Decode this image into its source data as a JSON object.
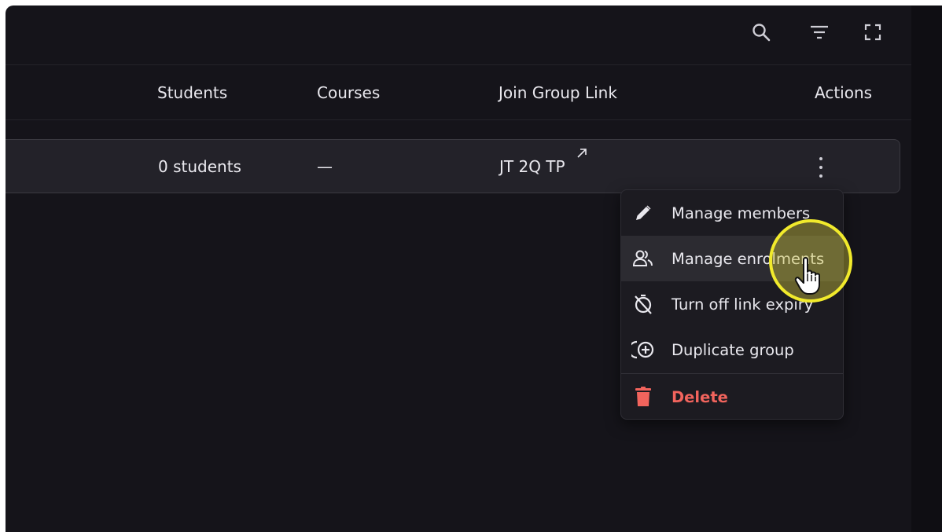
{
  "toolbar": {
    "icons": [
      "search-icon",
      "filter-icon",
      "fullscreen-icon"
    ]
  },
  "table": {
    "columns": [
      "Students",
      "Courses",
      "Join Group Link",
      "Actions"
    ],
    "rows": [
      {
        "students": "0 students",
        "courses": "—",
        "join_link": "JT 2Q TP",
        "join_link_icon": "external-link-icon",
        "actions_icon": "more-vertical-icon"
      }
    ]
  },
  "actions_menu": {
    "items": [
      {
        "label": "Manage members",
        "icon": "pencil-icon"
      },
      {
        "label": "Manage enrolments",
        "icon": "users-icon",
        "state": "hovered"
      },
      {
        "label": "Turn off link expiry",
        "icon": "timer-off-icon"
      },
      {
        "label": "Duplicate group",
        "icon": "duplicate-circle-plus-icon"
      },
      {
        "label": "Delete",
        "icon": "trash-icon",
        "variant": "danger"
      }
    ]
  },
  "colors": {
    "background": "#15141a",
    "row_background": "#232229",
    "text": "#e9e8ee",
    "danger": "#f2645d",
    "cursor_highlight": "#f1ea2c"
  }
}
